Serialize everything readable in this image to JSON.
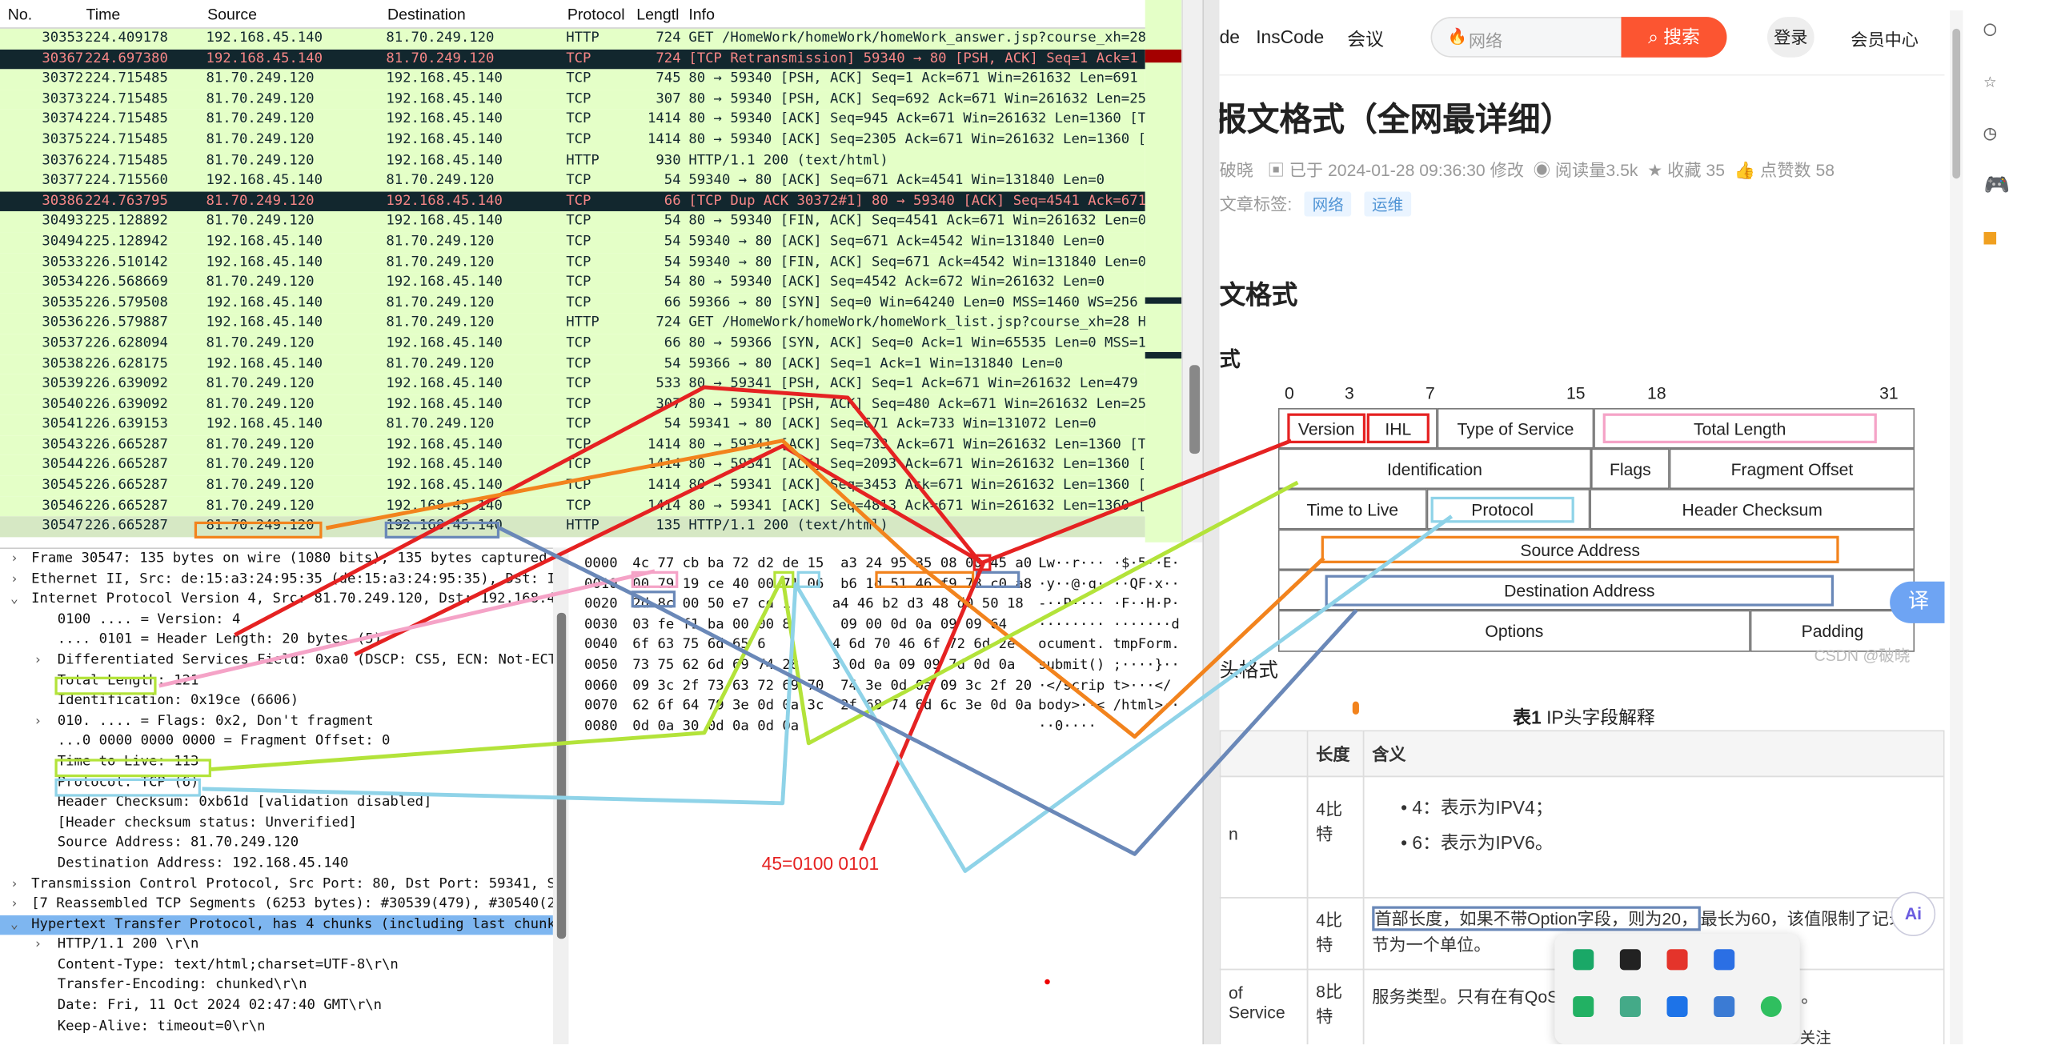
{
  "columns": [
    "No.",
    "Time",
    "Source",
    "Destination",
    "Protocol",
    "Lengtl",
    "Info"
  ],
  "packets": [
    [
      "30353",
      "224.409178",
      "192.168.45.140",
      "81.70.249.120",
      "HTTP",
      "724",
      "GET /HomeWork/homeWork/homeWork_answer.jsp?course_xh=28&…"
    ],
    [
      "30367",
      "224.697380",
      "192.168.45.140",
      "81.70.249.120",
      "TCP",
      "724",
      "[TCP Retransmission] 59340 → 80 [PSH, ACK] Seq=1 Ack=1 W…"
    ],
    [
      "30372",
      "224.715485",
      "81.70.249.120",
      "192.168.45.140",
      "TCP",
      "745",
      "80 → 59340 [PSH, ACK] Seq=1 Ack=671 Win=261632 Len=691 […"
    ],
    [
      "30373",
      "224.715485",
      "81.70.249.120",
      "192.168.45.140",
      "TCP",
      "307",
      "80 → 59340 [PSH, ACK] Seq=692 Ack=671 Win=261632 Len=253…"
    ],
    [
      "30374",
      "224.715485",
      "81.70.249.120",
      "192.168.45.140",
      "TCP",
      "1414",
      "80 → 59340 [ACK] Seq=945 Ack=671 Win=261632 Len=1360 [TC…"
    ],
    [
      "30375",
      "224.715485",
      "81.70.249.120",
      "192.168.45.140",
      "TCP",
      "1414",
      "80 → 59340 [ACK] Seq=2305 Ack=671 Win=261632 Len=1360 [T…"
    ],
    [
      "30376",
      "224.715485",
      "81.70.249.120",
      "192.168.45.140",
      "HTTP",
      "930",
      "HTTP/1.1 200    (text/html)"
    ],
    [
      "30377",
      "224.715560",
      "192.168.45.140",
      "81.70.249.120",
      "TCP",
      "54",
      "59340 → 80 [ACK] Seq=671 Ack=4541 Win=131840 Len=0"
    ],
    [
      "30386",
      "224.763795",
      "81.70.249.120",
      "192.168.45.140",
      "TCP",
      "66",
      "[TCP Dup ACK 30372#1] 80 → 59340 [ACK] Seq=4541 Ack=671 …"
    ],
    [
      "30493",
      "225.128892",
      "81.70.249.120",
      "192.168.45.140",
      "TCP",
      "54",
      "80 → 59340 [FIN, ACK] Seq=4541 Ack=671 Win=261632 Len=0"
    ],
    [
      "30494",
      "225.128942",
      "192.168.45.140",
      "81.70.249.120",
      "TCP",
      "54",
      "59340 → 80 [ACK] Seq=671 Ack=4542 Win=131840 Len=0"
    ],
    [
      "30533",
      "226.510142",
      "192.168.45.140",
      "81.70.249.120",
      "TCP",
      "54",
      "59340 → 80 [FIN, ACK] Seq=671 Ack=4542 Win=131840 Len=0"
    ],
    [
      "30534",
      "226.568669",
      "81.70.249.120",
      "192.168.45.140",
      "TCP",
      "54",
      "80 → 59340 [ACK] Seq=4542 Ack=672 Win=261632 Len=0"
    ],
    [
      "30535",
      "226.579508",
      "192.168.45.140",
      "81.70.249.120",
      "TCP",
      "66",
      "59366 → 80 [SYN] Seq=0 Win=64240 Len=0 MSS=1460 WS=256 S…"
    ],
    [
      "30536",
      "226.579887",
      "192.168.45.140",
      "81.70.249.120",
      "HTTP",
      "724",
      "GET /HomeWork/homeWork/homeWork_list.jsp?course_xh=28 HT…"
    ],
    [
      "30537",
      "226.628094",
      "81.70.249.120",
      "192.168.45.140",
      "TCP",
      "66",
      "80 → 59366 [SYN, ACK] Seq=0 Ack=1 Win=65535 Len=0 MSS=13…"
    ],
    [
      "30538",
      "226.628175",
      "192.168.45.140",
      "81.70.249.120",
      "TCP",
      "54",
      "59366 → 80 [ACK] Seq=1 Ack=1 Win=131840 Len=0"
    ],
    [
      "30539",
      "226.639092",
      "81.70.249.120",
      "192.168.45.140",
      "TCP",
      "533",
      "80 → 59341 [PSH, ACK] Seq=1 Ack=671 Win=261632 Len=479 […"
    ],
    [
      "30540",
      "226.639092",
      "81.70.249.120",
      "192.168.45.140",
      "TCP",
      "307",
      "80 → 59341 [PSH, ACK] Seq=480 Ack=671 Win=261632 Len=253…"
    ],
    [
      "30541",
      "226.639153",
      "192.168.45.140",
      "81.70.249.120",
      "TCP",
      "54",
      "59341 → 80 [ACK] Seq=671 Ack=733 Win=131072 Len=0"
    ],
    [
      "30543",
      "226.665287",
      "81.70.249.120",
      "192.168.45.140",
      "TCP",
      "1414",
      "80 → 59341 [ACK] Seq=733 Ack=671 Win=261632 Len=1360 [TC…"
    ],
    [
      "30544",
      "226.665287",
      "81.70.249.120",
      "192.168.45.140",
      "TCP",
      "1414",
      "80 → 59341 [ACK] Seq=2093 Ack=671 Win=261632 Len=1360 [T…"
    ],
    [
      "30545",
      "226.665287",
      "81.70.249.120",
      "192.168.45.140",
      "TCP",
      "1414",
      "80 → 59341 [ACK] Seq=3453 Ack=671 Win=261632 Len=1360 [T…"
    ],
    [
      "30546",
      "226.665287",
      "81.70.249.120",
      "192.168.45.140",
      "TCP",
      "1414",
      "80 → 59341 [ACK] Seq=4813 Ack=671 Win=261632 Len=1360 [T…"
    ],
    [
      "30547",
      "226.665287",
      "81.70.249.120",
      "192.168.45.140",
      "HTTP",
      "135",
      "HTTP/1.1 200    (text/html)"
    ]
  ],
  "details": [
    {
      "arrow": "›",
      "indent": 0,
      "text": "Frame 30547: 135 bytes on wire (1080 bits), 135 bytes captured (1…"
    },
    {
      "arrow": "›",
      "indent": 0,
      "text": "Ethernet II, Src: de:15:a3:24:95:35 (de:15:a3:24:95:35), Dst: Int…"
    },
    {
      "arrow": "⌄",
      "indent": 0,
      "text": "Internet Protocol Version 4, Src: 81.70.249.120, Dst: 192.168.45.…"
    },
    {
      "arrow": "",
      "indent": 1,
      "text": "0100 .... = Version: 4"
    },
    {
      "arrow": "",
      "indent": 1,
      "text": ".... 0101 = Header Length: 20 bytes (5)"
    },
    {
      "arrow": "›",
      "indent": 1,
      "text": "Differentiated Services Field: 0xa0 (DSCP: CS5, ECN: Not-ECT)"
    },
    {
      "arrow": "",
      "indent": 1,
      "text": "Total Length: 121"
    },
    {
      "arrow": "",
      "indent": 1,
      "text": "Identification: 0x19ce (6606)"
    },
    {
      "arrow": "›",
      "indent": 1,
      "text": "010. .... = Flags: 0x2, Don't fragment"
    },
    {
      "arrow": "",
      "indent": 1,
      "text": "...0 0000 0000 0000 = Fragment Offset: 0"
    },
    {
      "arrow": "",
      "indent": 1,
      "text": "Time to Live: 113"
    },
    {
      "arrow": "",
      "indent": 1,
      "text": "Protocol: TCP (6)"
    },
    {
      "arrow": "",
      "indent": 1,
      "text": "Header Checksum: 0xb61d [validation disabled]"
    },
    {
      "arrow": "",
      "indent": 1,
      "text": "[Header checksum status: Unverified]"
    },
    {
      "arrow": "",
      "indent": 1,
      "text": "Source Address: 81.70.249.120"
    },
    {
      "arrow": "",
      "indent": 1,
      "text": "Destination Address: 192.168.45.140"
    },
    {
      "arrow": "›",
      "indent": 0,
      "text": "Transmission Control Protocol, Src Port: 80, Dst Port: 59341, Seq…"
    },
    {
      "arrow": "›",
      "indent": 0,
      "text": "[7 Reassembled TCP Segments (6253 bytes): #30539(479), #30540(253…"
    },
    {
      "arrow": "⌄",
      "indent": 0,
      "text": "Hypertext Transfer Protocol, has 4 chunks (including last chunk)"
    },
    {
      "arrow": "›",
      "indent": 1,
      "text": "HTTP/1.1 200 \\r\\n"
    },
    {
      "arrow": "",
      "indent": 1,
      "text": "Content-Type: text/html;charset=UTF-8\\r\\n"
    },
    {
      "arrow": "",
      "indent": 1,
      "text": "Transfer-Encoding: chunked\\r\\n"
    },
    {
      "arrow": "",
      "indent": 1,
      "text": "Date: Fri, 11 Oct 2024 02:47:40 GMT\\r\\n"
    },
    {
      "arrow": "",
      "indent": 1,
      "text": "Keep-Alive: timeout=0\\r\\n"
    }
  ],
  "hex": [
    {
      "off": "0000",
      "bytes": "4c 77 cb ba 72 d2 de 15  a3 24 95 35 08 00 45 a0",
      "ascii": "Lw··r··· ·$·5··E·"
    },
    {
      "off": "0010",
      "bytes": "00 79 19 ce 40 00 71 06  b6 1d 51 46 f9 78 c0 a8",
      "ascii": "·y··@·q· ··QF·x··"
    },
    {
      "off": "0020",
      "bytes": "2d 8c 00 50 e7 cd 1     a4 46 b2 d3 48 d0 50 18",
      "ascii": "-··P···· ·F··H·P·"
    },
    {
      "off": "0030",
      "bytes": "03 fe f1 ba 00 00 8      09 00 0d 0a 09 09 64",
      "ascii": "········ ·······d"
    },
    {
      "off": "0040",
      "bytes": "6f 63 75 6d 65 6        4 6d 70 46 6f 72 6d 2e",
      "ascii": "ocument. tmpForm."
    },
    {
      "off": "0050",
      "bytes": "73 75 62 6d 69 74 28    3 0d 0a 09 09 7d 0d 0a",
      "ascii": "submit() ;····}··"
    },
    {
      "off": "0060",
      "bytes": "09 3c 2f 73 63 72 69 70  74 3e 0d 0a 09 3c 2f 20",
      "ascii": "·</scrip t>···</"
    },
    {
      "off": "0070",
      "bytes": "62 6f 64 79 3e 0d 0a 3c  2f 68 74 6d 6c 3e 0d 0a",
      "ascii": "body>··< /html>··"
    },
    {
      "off": "0080",
      "bytes": "0d 0a 30 0d 0a 0d 0a",
      "ascii": "··0····"
    }
  ],
  "annotation_note": "45=0100 0101",
  "web": {
    "nav": [
      "de",
      "InsCode",
      "会议"
    ],
    "search_placeholder": "网络",
    "search_button": "搜索",
    "login": "登录",
    "vip": "会员中心",
    "title": "报文格式（全网最详细）",
    "meta_author": "破晓",
    "meta_edit": "已于 2024-01-28 09:36:30 修改",
    "meta_views": "阅读量3.5k",
    "meta_collect": "收藏 35",
    "meta_like": "点赞数 58",
    "tags_label": "文章标签:",
    "tags": [
      "网络",
      "运维"
    ],
    "h2": "文格式",
    "h3": "式",
    "bits": [
      "0",
      "3",
      "7",
      "15",
      "18",
      "31"
    ],
    "fields": {
      "version": "Version",
      "ihl": "IHL",
      "tos": "Type of Service",
      "total_length": "Total Length",
      "identification": "Identification",
      "flags": "Flags",
      "fragment_offset": "Fragment Offset",
      "ttl": "Time to Live",
      "protocol": "Protocol",
      "checksum": "Header Checksum",
      "src": "Source Address",
      "dst": "Destination Address",
      "options": "Options",
      "padding": "Padding"
    },
    "watermark": "CSDN @破晓",
    "para": "头格式",
    "caption_bold": "表1",
    "caption": " IP头字段解释",
    "th_len": "长度",
    "th_meaning": "含义",
    "row1_name": "n",
    "row1_len": "4比特",
    "row1_items": [
      "4：表示为IPV4；",
      "6：表示为IPV6。"
    ],
    "row2_len": "4比特",
    "row2_text_hl": "首部长度，如果不带Option字段，则为20，",
    "row2_text": "最长为60，该值限制了记录字节为一个单位。",
    "row3_name": "of Service",
    "row3_len": "8比特",
    "row3_text": "服务类型。只有在有QoS",
    "row3_tail": "用。",
    "translate": "译",
    "ai": "Ai",
    "follow": "关注"
  },
  "colors": {
    "bad_row_bg": "#12272e",
    "bad_row_fg": "#f78787",
    "row_bg": "#e4ffc7",
    "search_btn": "#fc5531",
    "red": "#e52222",
    "orange": "#f2831d",
    "green": "#b3e33a",
    "lightblue": "#8fd3e8",
    "steel": "#6a88b8",
    "pink": "#f5a3c7"
  }
}
